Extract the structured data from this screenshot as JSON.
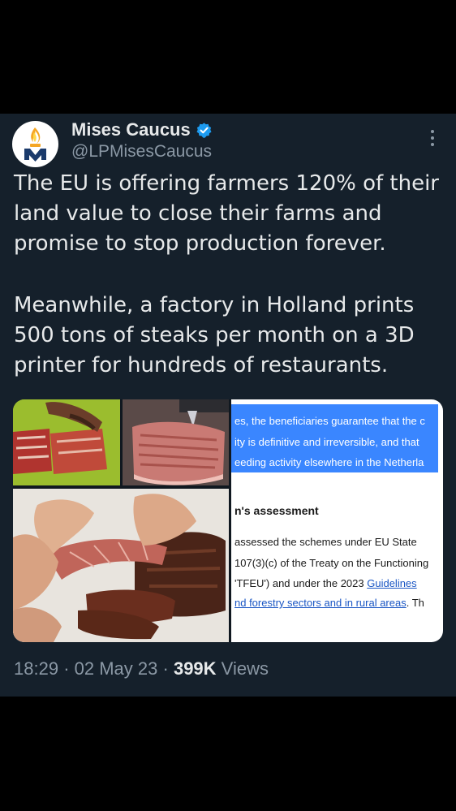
{
  "author": {
    "name": "Mises Caucus",
    "handle": "@LPMisesCaucus",
    "verified": true,
    "avatar_icon": "torch-logo-icon"
  },
  "tweet": {
    "paragraphs": [
      "The EU is offering farmers 120% of their land value to close their farms and promise to stop production forever.",
      "Meanwhile, a factory in Holland prints 500 tons of steaks per month on a 3D printer for hundreds of restaurants."
    ]
  },
  "media": {
    "photos": [
      "sliced-steak-photo",
      "3d-printing-meat-photo",
      "stretched-steak-photo"
    ],
    "document": {
      "highlighted_lines": [
        "es, the beneficiaries guarantee that the c",
        "ity is definitive and irreversible, and that",
        "eeding activity elsewhere in the Netherla"
      ],
      "heading": "n's assessment",
      "line1": "assessed the schemes under EU State",
      "line2": "107(3)(c) of the Treaty on the Functioning",
      "line3_prefix": "'TFEU') and under the 2023 ",
      "line3_link": "Guidelines",
      "line4_link": "nd forestry sectors and in rural areas",
      "line4_suffix": ". Th"
    }
  },
  "meta": {
    "time": "18:29",
    "separator": "·",
    "date": "02 May 23",
    "views_count": "399K",
    "views_label": "Views"
  },
  "colors": {
    "background": "#15202b",
    "text": "#e7e9ea",
    "secondary": "#8b98a5",
    "verified_badge": "#1d9bf0",
    "doc_highlight": "#3a86ff"
  }
}
